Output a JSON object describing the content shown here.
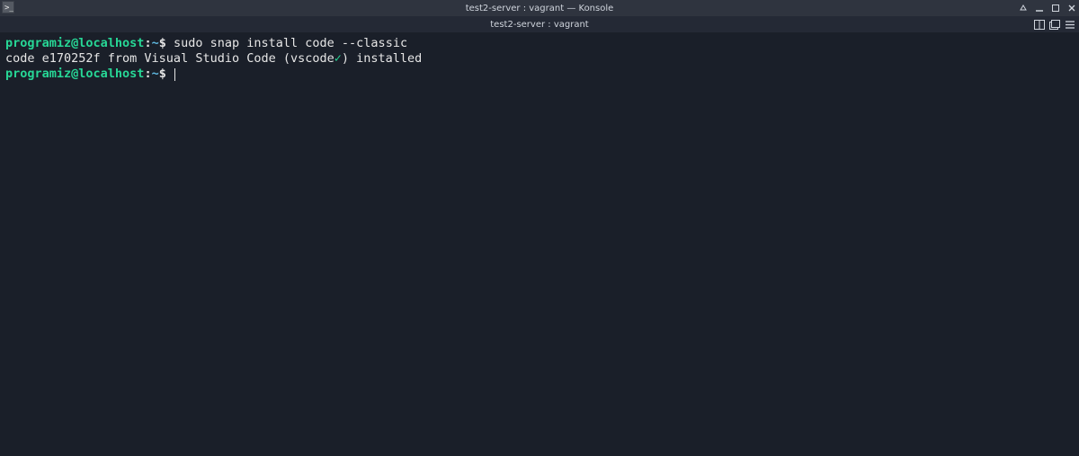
{
  "titlebar": {
    "title": "test2-server : vagrant — Konsole"
  },
  "tab": {
    "label": "test2-server : vagrant"
  },
  "prompt": {
    "user_host": "programiz@localhost",
    "colon": ":",
    "path": "~",
    "dollar": "$"
  },
  "lines": {
    "cmd1": " sudo snap install code --classic",
    "out1_pre": "code e170252f from Visual Studio Code (vscode",
    "out1_check": "✓",
    "out1_post": ") installed",
    "cmd2": " "
  }
}
